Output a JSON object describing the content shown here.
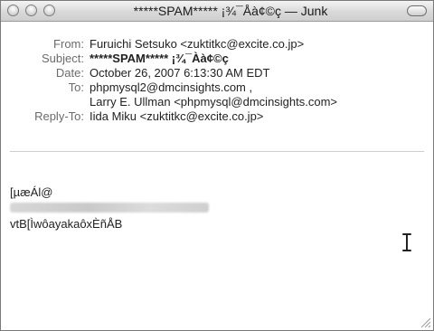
{
  "window": {
    "title": "*****SPAM***** ¡¾¯Åà¢©ç — Junk"
  },
  "headers": [
    {
      "label": "From:",
      "value": "Furuichi Setsuko <zuktitkc@excite.co.jp>",
      "bold": false
    },
    {
      "label": "Subject:",
      "value": "*****SPAM***** ¡¾¯Àà¢©ç",
      "bold": true
    },
    {
      "label": "Date:",
      "value": "October 26, 2007 6:13:30 AM EDT",
      "bold": false
    },
    {
      "label": "To:",
      "value": "phpmysql2@dmcinsights.com ,",
      "bold": false
    },
    {
      "label": "",
      "value": "Larry E. Ullman <phpmysql@dmcinsights.com>",
      "bold": false
    },
    {
      "label": "Reply-To:",
      "value": "Iida Miku <zuktitkc@excite.co.jp>",
      "bold": false
    }
  ],
  "body": {
    "line1": "[µæÁl@",
    "line3": "vtB[ÌwôayakaôxÈñÅB"
  },
  "icons": {
    "cursor": "text-cursor-icon"
  },
  "colors": {
    "label": "#6b6b6b",
    "text": "#222222"
  }
}
